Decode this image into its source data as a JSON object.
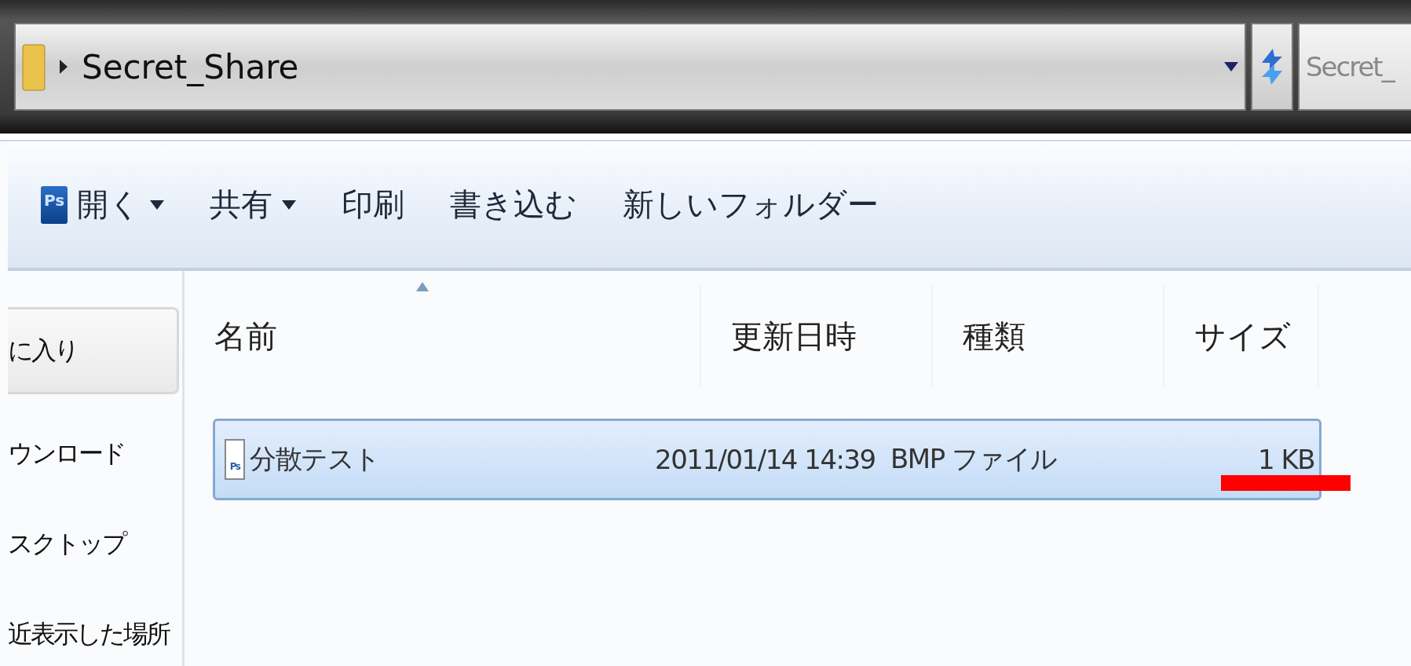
{
  "address_bar": {
    "path": "Secret_Share",
    "search_placeholder": "Secret_"
  },
  "toolbar": [
    {
      "kind": "app",
      "label": "開く",
      "icon_label": "Ps",
      "dropdown": true
    },
    {
      "kind": "plain",
      "label": "共有",
      "dropdown": true
    },
    {
      "kind": "plain",
      "label": "印刷",
      "dropdown": false
    },
    {
      "kind": "plain",
      "label": "書き込む",
      "dropdown": false
    },
    {
      "kind": "plain",
      "label": "新しいフォルダー",
      "dropdown": false
    }
  ],
  "sidebar": {
    "items": [
      {
        "label": "に入り",
        "selected": true
      },
      {
        "label": "ウンロード",
        "selected": false
      },
      {
        "label": "スクトップ",
        "selected": false
      },
      {
        "label": "近表示した場所",
        "selected": false
      }
    ]
  },
  "table": {
    "columns": [
      {
        "label": "名前",
        "sorted": true
      },
      {
        "label": "更新日時",
        "sorted": false
      },
      {
        "label": "種類",
        "sorted": false
      },
      {
        "label": "サイズ",
        "sorted": false
      }
    ],
    "rows": [
      {
        "name": "分散テスト",
        "icon_label": "Ps",
        "modified": "2011/01/14 14:39",
        "type": "BMP ファイル",
        "size": "1 KB",
        "selected": true,
        "marked": true
      }
    ]
  }
}
